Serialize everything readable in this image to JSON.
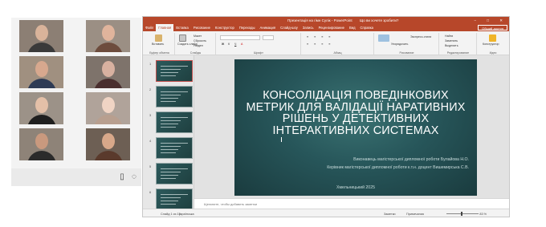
{
  "conference": {
    "participants": [
      {
        "skin": "#d9b39a",
        "shirt": "#3a3a3a",
        "bg": "#8c7f74"
      },
      {
        "skin": "#e0b49c",
        "shirt": "#6d4c3d",
        "bg": "#9b8f84"
      },
      {
        "skin": "#d7a88e",
        "shirt": "#2e3b55",
        "bg": "#a09080"
      },
      {
        "skin": "#d8b1a0",
        "shirt": "#4a2f2f",
        "bg": "#7e736b"
      },
      {
        "skin": "#e4c0a8",
        "shirt": "#1f1f1f",
        "bg": "#9c9288"
      },
      {
        "skin": "#f0d4c4",
        "shirt": "#b89f8f",
        "bg": "#b0a39a"
      },
      {
        "skin": "#c9997e",
        "shirt": "#2b2b2b",
        "bg": "#8e8378"
      },
      {
        "skin": "#d8a88a",
        "shirt": "#5a3a2c",
        "bg": "#6d5f54"
      }
    ],
    "toolbar_icons": [
      "document-icon",
      "chat-icon"
    ]
  },
  "ppt": {
    "window_title": "Презентація на гімн Сулік - PowerPoint",
    "search_hint": "Що ви хочете зробити?",
    "window_controls": "–  □  ✕",
    "tabs": [
      "Файл",
      "Главная",
      "Вставка",
      "Рисование",
      "Конструктор",
      "Переходы",
      "Анимация",
      "Слайд-шоу",
      "Запись",
      "Рецензирование",
      "Вид",
      "Справка"
    ],
    "active_tab": 1,
    "share_label": "Общий доступ",
    "ribbon": {
      "paste": "Вставить",
      "clipboard": "Буфер обмена",
      "new_slide": "Создать слайд",
      "layout": "Макет",
      "reset": "Сбросить",
      "section": "Раздел",
      "slides": "Слайды",
      "font": "Шрифт",
      "paragraph": "Абзац",
      "arrange": "Упорядочить",
      "quick_styles": "Экспресс-стили",
      "drawing": "Рисование",
      "find": "Найти",
      "replace": "Заменить",
      "select": "Выделить",
      "editing": "Редактирование",
      "designer": "Конструктор",
      "designer_label": "Идеи"
    },
    "slide": {
      "title": "КОНСОЛІДАЦІЯ ПОВЕДІНКОВИХ МЕТРИК ДЛЯ ВАЛІДАЦІЇ НАРАТИВНИХ РІШЕНЬ У ДЕТЕКТИВНИХ ІНТЕРАКТИВНИХ СИСТЕМАХ",
      "author_line": "Виконавець магістерської дипломної роботи Булайова Н.О.",
      "supervisor_line": "Керівник магістерської дипломної роботи к.т.н. доцент Вишемирська С.В.",
      "city_year": "Хмельницький 2025"
    },
    "thumb_numbers": [
      "1",
      "2",
      "3",
      "4",
      "5",
      "6"
    ],
    "notes_placeholder": "Щелкните, чтобы добавить заметки",
    "status": {
      "slide_counter": "Слайд 1 из 15",
      "language": "українська",
      "notes_btn": "Заметки",
      "comments_btn": "Примечания",
      "zoom": "83 %"
    }
  }
}
